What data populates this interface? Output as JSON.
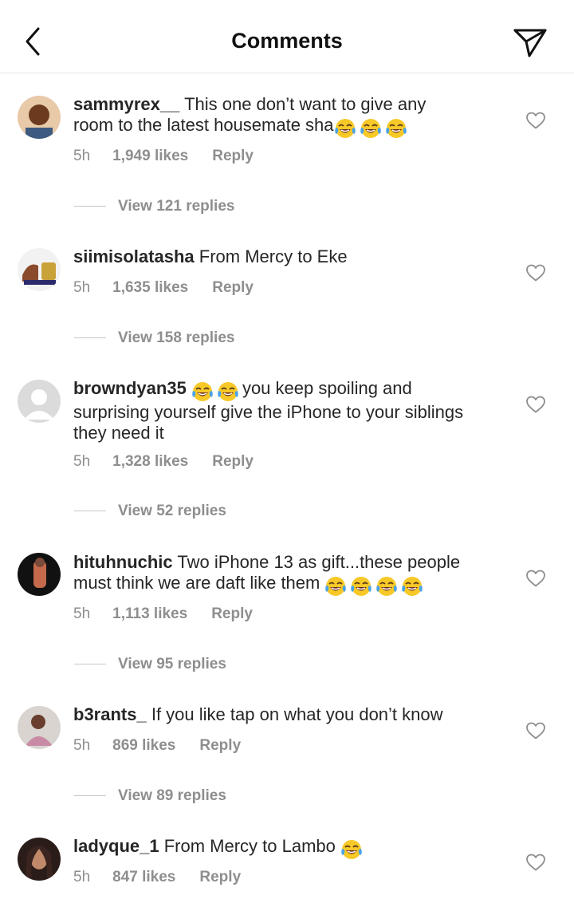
{
  "header": {
    "title": "Comments"
  },
  "comments": [
    {
      "username": "sammyrex__",
      "text_line1": "This one don’t want to give any",
      "text_line2": "room to the latest housemate sha",
      "emoji_count": 3,
      "time": "5h",
      "likes": "1,949 likes",
      "reply": "Reply",
      "view_replies": "View 121 replies",
      "avatar_color": "#a0522d"
    },
    {
      "username": "siimisolatasha",
      "text_line1": "From Mercy to Eke",
      "time": "5h",
      "likes": "1,635 likes",
      "reply": "Reply",
      "view_replies": "View 158 replies",
      "avatar_color": "#8b4a2b"
    },
    {
      "username": "browndyan35",
      "text_line1": "you keep spoiling and",
      "text_line2": "surprising yourself give the iPhone to your siblings",
      "text_line3": "they need it",
      "emoji_count": 2,
      "time": "5h",
      "likes": "1,328 likes",
      "reply": "Reply",
      "view_replies": "View 52 replies",
      "avatar_color": "#dbdbdb"
    },
    {
      "username": "hituhnuchic",
      "text_line1": "Two iPhone 13 as gift...these people",
      "text_line2": "must think we are daft like them",
      "emoji_count": 4,
      "time": "5h",
      "likes": "1,113 likes",
      "reply": "Reply",
      "view_replies": "View 95 replies",
      "avatar_color": "#1a1a1a"
    },
    {
      "username": "b3rants_",
      "text_line1": "If you like tap on what you don’t know",
      "time": "5h",
      "likes": "869 likes",
      "reply": "Reply",
      "view_replies": "View 89 replies",
      "avatar_color": "#7a6a6a"
    },
    {
      "username": "ladyque_1",
      "text_line1": "From Mercy to Lambo",
      "emoji_count": 1,
      "time": "5h",
      "likes": "847 likes",
      "reply": "Reply",
      "avatar_color": "#3a2a24"
    }
  ],
  "icons": {
    "back": "chevron-left-icon",
    "send": "paper-plane-icon",
    "like": "heart-outline-icon",
    "emoji": "face-with-tears-of-joy-emoji"
  },
  "colors": {
    "text": "#262626",
    "secondary": "#8e8e8e",
    "divider": "#e6e6e6"
  }
}
